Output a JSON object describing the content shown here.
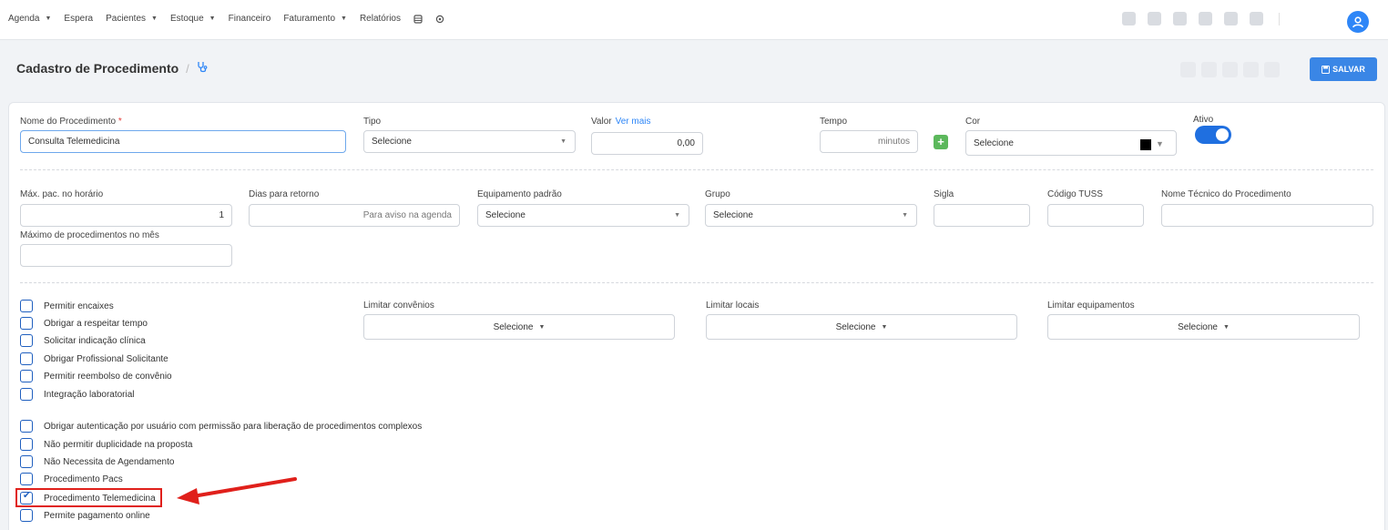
{
  "nav": {
    "items": [
      {
        "label": "Agenda",
        "caret": true
      },
      {
        "label": "Espera",
        "caret": false
      },
      {
        "label": "Pacientes",
        "caret": true
      },
      {
        "label": "Estoque",
        "caret": true
      },
      {
        "label": "Financeiro",
        "caret": false
      },
      {
        "label": "Faturamento",
        "caret": true
      },
      {
        "label": "Relatórios",
        "caret": false
      }
    ],
    "extra_icons": [
      "database-icon",
      "gear-icon"
    ],
    "toolbar_icons": [
      "pen-icon",
      "id-card-icon",
      "tool-icon",
      "plus-icon",
      "edit-icon",
      "printer-icon"
    ],
    "avatar_icon": "user-icon"
  },
  "header": {
    "title": "Cadastro de Procedimento",
    "separator": "/",
    "icon": "stethoscope-icon",
    "save_label": "SALVAR",
    "save_icon": "floppy-icon"
  },
  "form": {
    "nome": {
      "label": "Nome do Procedimento",
      "required_mark": "*",
      "value": "Consulta Telemedicina"
    },
    "tipo": {
      "label": "Tipo",
      "value": "Selecione"
    },
    "valor": {
      "label": "Valor",
      "link": "Ver mais",
      "value": "0,00"
    },
    "tempo": {
      "label": "Tempo",
      "placeholder": "minutos"
    },
    "cor": {
      "label": "Cor",
      "value": "Selecione",
      "color": "#000000"
    },
    "ativo": {
      "label": "Ativo",
      "on": true,
      "accent": "#1f6fe0"
    },
    "max_pac": {
      "label": "Máx. pac. no horário",
      "value": "1"
    },
    "dias_retorno": {
      "label": "Dias para retorno",
      "placeholder": "Para aviso na agenda"
    },
    "equipamento": {
      "label": "Equipamento padrão",
      "value": "Selecione"
    },
    "grupo": {
      "label": "Grupo",
      "value": "Selecione"
    },
    "sigla": {
      "label": "Sigla"
    },
    "tuss": {
      "label": "Código TUSS"
    },
    "nome_tecnico": {
      "label": "Nome Técnico do Procedimento"
    },
    "max_mes": {
      "label": "Máximo de procedimentos no mês"
    },
    "limitar_convenios": {
      "label": "Limitar convênios",
      "value": "Selecione"
    },
    "limitar_locais": {
      "label": "Limitar locais",
      "value": "Selecione"
    },
    "limitar_equipamentos": {
      "label": "Limitar equipamentos",
      "value": "Selecione"
    }
  },
  "checkboxes_a": [
    {
      "label": "Permitir encaixes",
      "checked": false
    },
    {
      "label": "Obrigar a respeitar tempo",
      "checked": false
    },
    {
      "label": "Solicitar indicação clínica",
      "checked": false
    },
    {
      "label": "Obrigar Profissional Solicitante",
      "checked": false
    },
    {
      "label": "Permitir reembolso de convênio",
      "checked": false
    },
    {
      "label": "Integração laboratorial",
      "checked": false
    }
  ],
  "checkboxes_b": [
    {
      "label": "Obrigar autenticação por usuário com permissão para liberação de procedimentos complexos",
      "checked": false
    },
    {
      "label": "Não permitir duplicidade na proposta",
      "checked": false
    },
    {
      "label": "Não Necessita de Agendamento",
      "checked": false
    },
    {
      "label": "Procedimento Pacs",
      "checked": false
    },
    {
      "label": "Procedimento Telemedicina",
      "checked": true
    },
    {
      "label": "Permite pagamento online",
      "checked": false
    }
  ],
  "annotation": {
    "highlight_color": "#e0201b"
  }
}
